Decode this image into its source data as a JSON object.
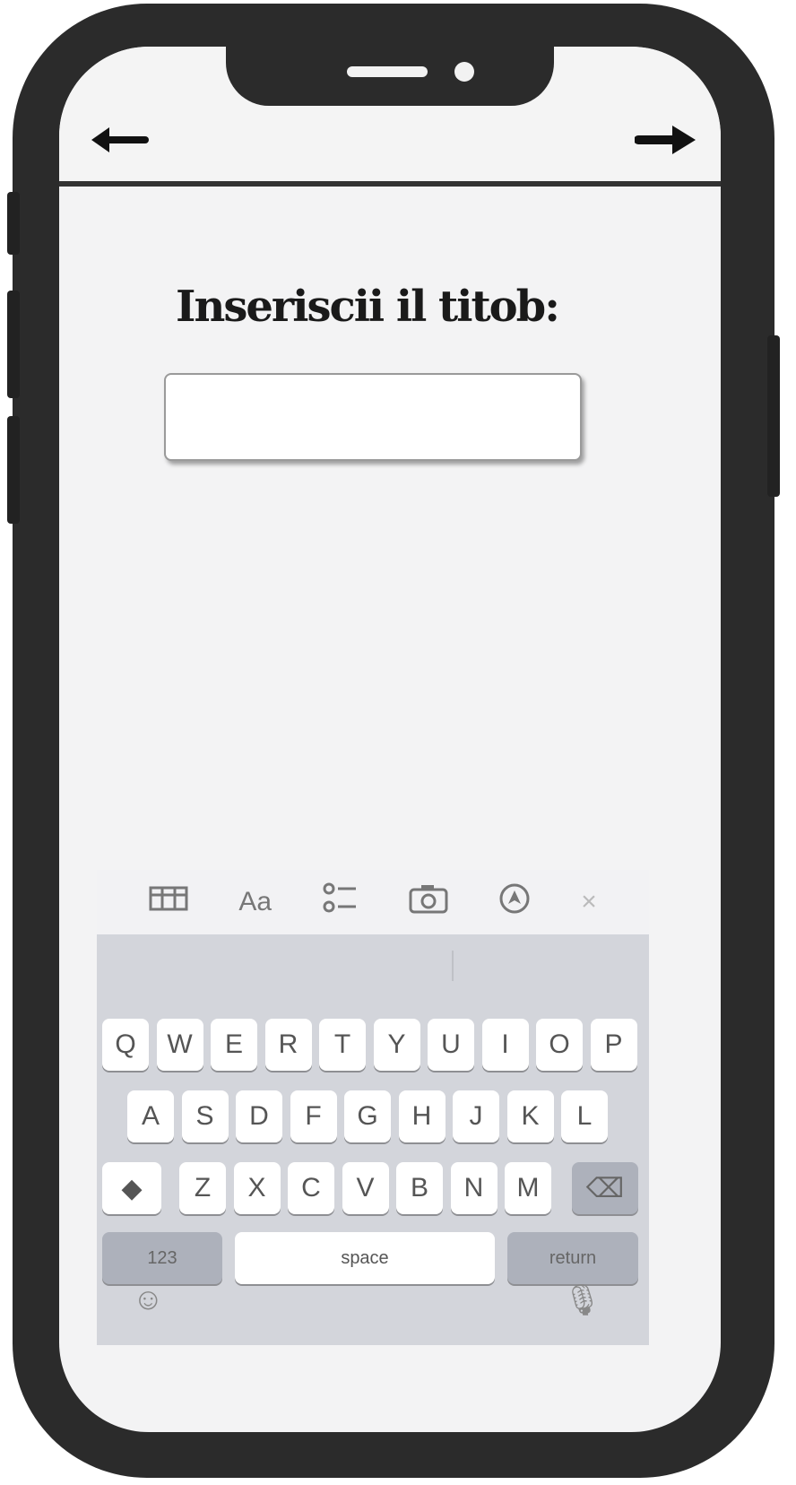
{
  "screen": {
    "prompt_label": "Inseriscii il titob:",
    "input_value": ""
  },
  "nav": {
    "back_icon": "arrow-left-icon",
    "forward_icon": "arrow-right-icon"
  },
  "keyboard": {
    "toolbar_icons": [
      "table-icon",
      "text-format-icon",
      "checklist-icon",
      "camera-icon",
      "navigate-icon",
      "close-icon"
    ],
    "toolbar_text_format": "Aa",
    "toolbar_close": "×",
    "row1": [
      "Q",
      "W",
      "E",
      "R",
      "T",
      "Y",
      "U",
      "I",
      "O",
      "P"
    ],
    "row2": [
      "A",
      "S",
      "D",
      "F",
      "G",
      "H",
      "J",
      "K",
      "L"
    ],
    "row3": [
      "Z",
      "X",
      "C",
      "V",
      "B",
      "N",
      "M"
    ],
    "numbers_key": "123",
    "space_key": "space",
    "return_key": "return",
    "shift_glyph": "◆",
    "delete_glyph": "⌫",
    "emoji_glyph": "☺",
    "mic_glyph": "🎙"
  },
  "colors": {
    "frame": "#2b2b2b",
    "screen": "#f3f3f4",
    "keyboard": "#d3d5db"
  }
}
